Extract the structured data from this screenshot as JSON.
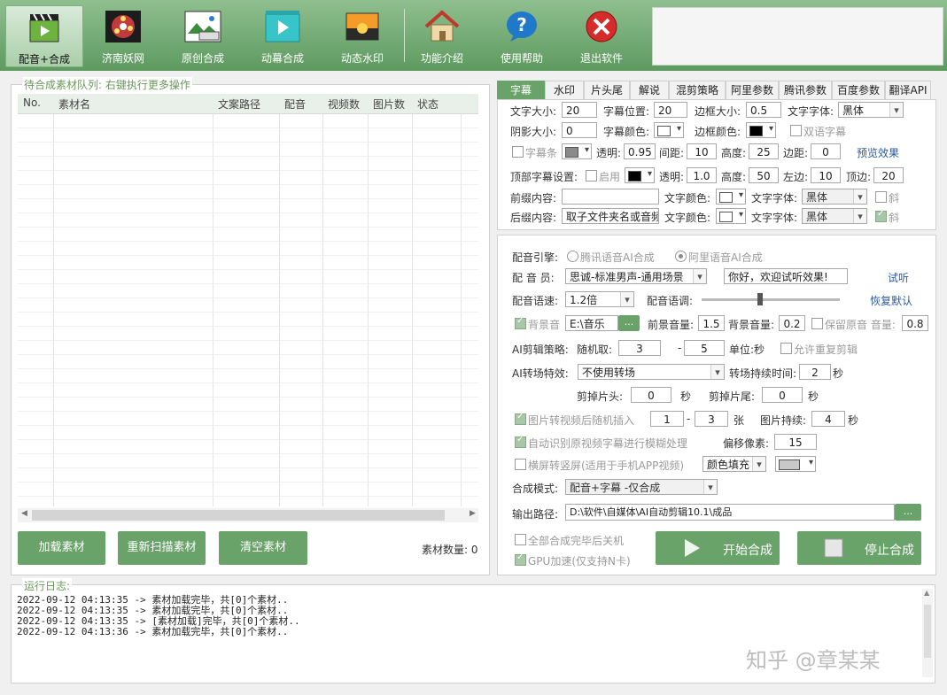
{
  "toolbar": {
    "buttons": [
      {
        "label": "配音+合成",
        "icon": "clapperboard-icon"
      },
      {
        "label": "济南妖网",
        "icon": "film-reel-icon"
      },
      {
        "label": "原创合成",
        "icon": "image-settings-icon"
      },
      {
        "label": "动幕合成",
        "icon": "play-clapper-icon"
      },
      {
        "label": "动态水印",
        "icon": "sunset-photo-icon"
      },
      {
        "label": "功能介绍",
        "icon": "house-icon"
      },
      {
        "label": "使用帮助",
        "icon": "help-bubble-icon"
      },
      {
        "label": "退出软件",
        "icon": "exit-x-icon"
      }
    ]
  },
  "queue": {
    "title": "待合成素材队列: 右键执行更多操作",
    "columns": [
      "No.",
      "素材名",
      "文案路径",
      "配音",
      "视频数",
      "图片数",
      "状态"
    ],
    "buttons": {
      "load": "加载素材",
      "rescan": "重新扫描素材",
      "clear": "清空素材"
    },
    "count_label": "素材数量: 0"
  },
  "tabs": [
    "字幕",
    "水印",
    "片头尾",
    "解说",
    "混剪策略",
    "阿里参数",
    "腾讯参数",
    "百度参数",
    "翻译API"
  ],
  "subtitle": {
    "font_size_label": "文字大小:",
    "font_size": "20",
    "position_label": "字幕位置:",
    "position": "20",
    "border_size_label": "边框大小:",
    "border_size": "0.5",
    "font_family_label": "文字字体:",
    "font_family": "黑体",
    "shadow_label": "阴影大小:",
    "shadow": "0",
    "color_label": "字幕颜色:",
    "border_color_label": "边框颜色:",
    "dual_label": "双语字幕",
    "bar_label": "字幕条",
    "opacity_label": "透明:",
    "opacity": "0.95",
    "spacing_label": "间距:",
    "spacing": "10",
    "height_label": "高度:",
    "height": "25",
    "margin_label": "边距:",
    "margin": "0",
    "preview_link": "预览效果",
    "top_label": "顶部字幕设置:",
    "enable_label": "启用",
    "top_opacity_label": "透明:",
    "top_opacity": "1.0",
    "top_height_label": "高度:",
    "top_height": "50",
    "left_label": "左边:",
    "left": "10",
    "top_edge_label": "顶边:",
    "top_edge": "20",
    "prefix_label": "前缀内容:",
    "prefix": "",
    "prefix_color_label": "文字颜色:",
    "prefix_font_label": "文字字体:",
    "prefix_font": "黑体",
    "prefix_italic": "斜",
    "suffix_label": "后缀内容:",
    "suffix": "取子文件夹名或音频",
    "suffix_color_label": "文字颜色:",
    "suffix_font_label": "文字字体:",
    "suffix_font": "黑体",
    "suffix_italic": "斜"
  },
  "voice": {
    "engine_label": "配音引擎:",
    "engine_tencent": "腾讯语音AI合成",
    "engine_ali": "阿里语音AI合成",
    "voicer_label": "配 音 员:",
    "voicer": "思诚-标准男声-通用场景",
    "sample_text": "你好，欢迎试听效果!",
    "try_link": "试听",
    "speed_label": "配音语速:",
    "speed": "1.2倍",
    "tone_label": "配音语调:",
    "tone_level": 0.42,
    "reset_link": "恢复默认",
    "bgm_label": "背景音",
    "bgm_path": "E:\\音乐",
    "browse": "...",
    "front_vol_label": "前景音量:",
    "front_vol": "1.5",
    "back_vol_label": "背景音量:",
    "back_vol": "0.2",
    "keep_orig_label": "保留原音 音量:",
    "keep_orig_vol": "0.8",
    "cut_label": "AI剪辑策略:",
    "random_label": "随机取:",
    "rand_min": "3",
    "dash": "-",
    "rand_max": "5",
    "unit_label": "单位:秒",
    "allow_repeat": "允许重复剪辑",
    "trans_label": "AI转场特效:",
    "trans_value": "不使用转场",
    "trans_dur_label": "转场持续时间:",
    "trans_dur": "2",
    "sec": "秒",
    "cut_head_label": "剪掉片头:",
    "cut_head": "0",
    "cut_tail_label": "剪掉片尾:",
    "cut_tail": "0",
    "img_insert_label": "图片转视频后随机插入",
    "img_min": "1",
    "img_max": "3",
    "img_unit": "张",
    "img_dur_label": "图片持续:",
    "img_dur": "4",
    "blur_label": "自动识别原视频字幕进行模糊处理",
    "offset_label": "偏移像素:",
    "offset": "15",
    "vertical_label": "横屏转竖屏(适用于手机APP视频)",
    "fill_mode": "颜色填充",
    "mode_label": "合成模式:",
    "mode_value": "配音+字幕 -仅合成",
    "output_label": "输出路径:",
    "output_path": "D:\\软件\\自媒体\\AI自动剪辑10.1\\成品",
    "shutdown_label": "全部合成完毕后关机",
    "gpu_label": "GPU加速(仅支持N卡)",
    "start_label": "开始合成",
    "stop_label": "停止合成"
  },
  "log": {
    "title": "运行日志:",
    "lines": [
      "2022-09-12 04:13:35 -> 素材加载完毕，共[0]个素材..",
      "2022-09-12 04:13:35 -> 素材加载完毕，共[0]个素材..",
      "2022-09-12 04:13:35 -> [素材加载]完毕，共[0]个素材..",
      "2022-09-12 04:13:36 -> 素材加载完毕，共[0]个素材.."
    ]
  },
  "watermark": "知乎 @章某某",
  "colors": {
    "accent": "#6aa36a",
    "toolbar": "#6fa86f"
  }
}
